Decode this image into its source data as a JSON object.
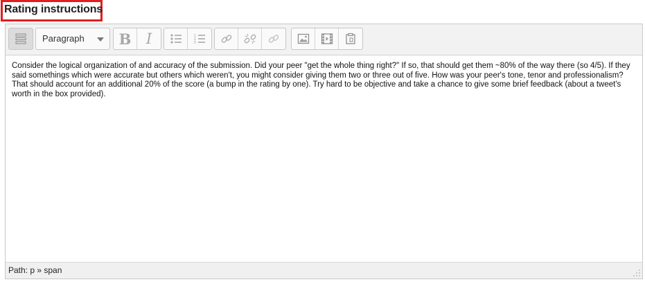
{
  "section": {
    "title": "Rating instructions"
  },
  "toolbar": {
    "format_select": {
      "value": "Paragraph"
    },
    "buttons": {
      "toggle": {
        "icon": "toolbar-toggle-icon"
      },
      "bold": {
        "glyph": "B"
      },
      "italic": {
        "glyph": "I"
      },
      "unordered_list": {
        "icon": "bullet-list-icon"
      },
      "ordered_list": {
        "icon": "numbered-list-icon"
      },
      "link": {
        "icon": "link-icon"
      },
      "unlink": {
        "icon": "unlink-icon"
      },
      "anchor": {
        "icon": "anchor-link-icon"
      },
      "image": {
        "icon": "image-icon"
      },
      "media": {
        "icon": "media-icon"
      },
      "paste": {
        "icon": "paste-icon"
      }
    }
  },
  "editor": {
    "content": "Consider the logical organization of and accuracy of the submission.  Did your peer \"get the whole thing right?\"  If so, that should get them ~80% of the way there (so 4/5).  If they said somethings which were accurate but others which weren't, you might consider giving them two or three out of five.  How was your peer's tone, tenor and professionalism?  That should account for an additional 20% of the score (a bump in the rating by one).  Try hard to be objective and take a chance to give some brief feedback (about a tweet's worth in the box provided)."
  },
  "statusbar": {
    "path": "Path: p » span"
  },
  "colors": {
    "highlight_border": "#e01e1e",
    "toolbar_bg": "#f2f2f2",
    "icon_gray": "#a8a8a8"
  }
}
